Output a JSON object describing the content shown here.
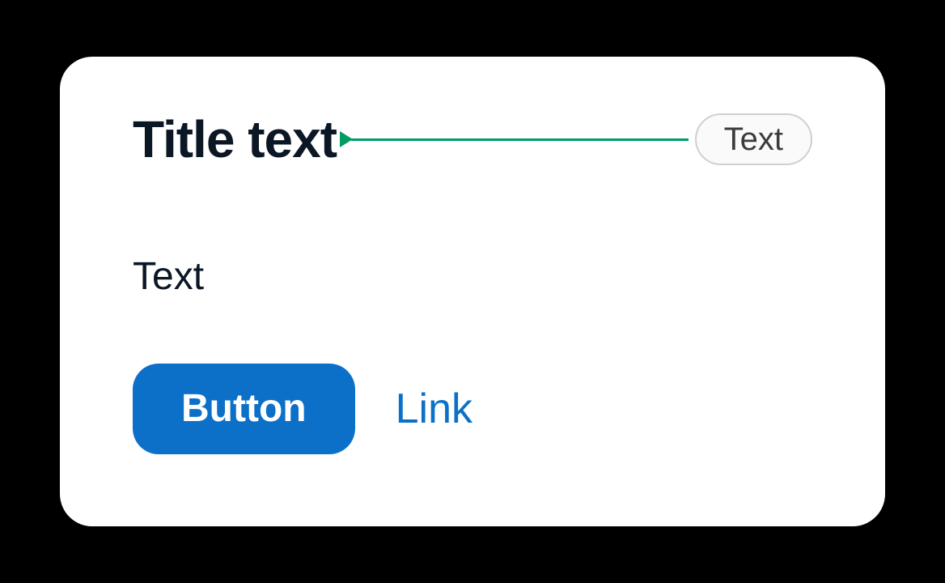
{
  "card": {
    "title": "Title text",
    "badge": "Text",
    "body": "Text",
    "button": "Button",
    "link": "Link"
  },
  "colors": {
    "accent_green": "#009c63",
    "primary_blue": "#0d70c8",
    "title_dark": "#0b1724",
    "badge_border": "#cfcfcf"
  }
}
